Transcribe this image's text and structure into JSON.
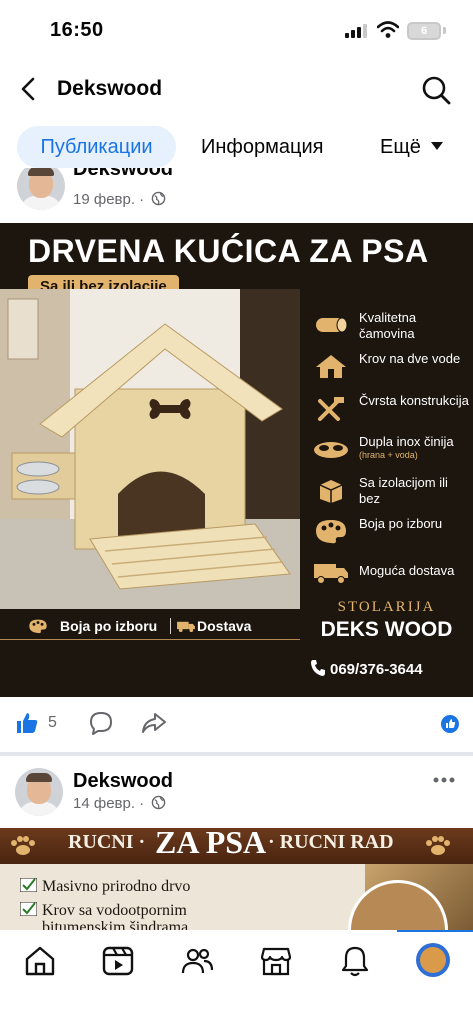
{
  "status_bar": {
    "time": "16:50",
    "battery": "6"
  },
  "header": {
    "title": "Dekswood"
  },
  "tabs": {
    "active": "Публикации",
    "info": "Информация",
    "more": "Ещё"
  },
  "post1": {
    "name": "Dekswood",
    "date": "19 февр. ·",
    "image": {
      "title": "DRVENA KUĆICA ZA PSA",
      "pill": "Sa ili bez izolacije",
      "features": [
        {
          "icon": "log-icon",
          "text": "Kvalitetna čamovina",
          "sub": ""
        },
        {
          "icon": "house-icon",
          "text": "Krov na dve vode",
          "sub": ""
        },
        {
          "icon": "tools-icon",
          "text": "Čvrsta konstrukcija",
          "sub": ""
        },
        {
          "icon": "bowl-icon",
          "text": "Dupla inox činija",
          "sub": "(hrana + voda)"
        },
        {
          "icon": "package-icon",
          "text": "Sa izolacijom ili bez",
          "sub": ""
        },
        {
          "icon": "palette-icon",
          "text": "Boja po izboru",
          "sub": ""
        },
        {
          "icon": "truck-icon",
          "text": "Moguća dostava",
          "sub": ""
        }
      ],
      "bottom_color": "Boja po izboru",
      "bottom_delivery": "Dostava",
      "brand_top": "STOLARIJA",
      "brand_name": "DEKS WOOD",
      "phone": "069/376-3644"
    },
    "likes": "5"
  },
  "post2": {
    "name": "Dekswood",
    "date": "14 февр. ·",
    "banner_left": "RUCNI ·",
    "banner_center": "ZA PSA",
    "banner_right": "· RUCNI RAD",
    "items": [
      "Masivno prirodno drvo",
      "Krov sa vodootpornim",
      "bitumenskim šindrama"
    ]
  },
  "colors": {
    "accent": "#1b74e4",
    "active_tab_bg": "#e7f0fd",
    "ad_gold": "#e2b36c",
    "ad_dark": "#1d160f"
  }
}
